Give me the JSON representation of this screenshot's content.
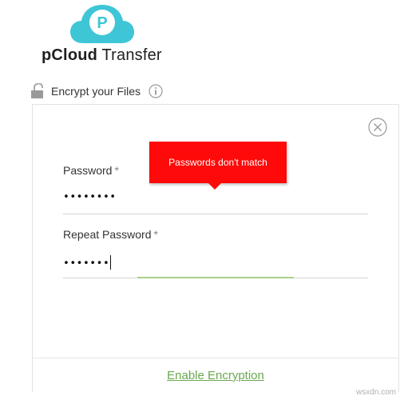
{
  "app": {
    "brand_bold": "pCloud",
    "brand_rest": " Transfer",
    "logo_letter": "P",
    "brand_color": "#3ec6d6"
  },
  "encrypt": {
    "label": "Encrypt your Files",
    "lock_icon": "padlock-open-icon",
    "info_icon": "info-circle-icon"
  },
  "form": {
    "password": {
      "label": "Password",
      "required": "*",
      "value": "••••••••"
    },
    "repeat_password": {
      "label": "Repeat Password",
      "required": "*",
      "value": "•••••••"
    },
    "error_tooltip": "Passwords don't match",
    "error_color": "#ff0a0a"
  },
  "footer": {
    "enable_label": "Enable Encryption",
    "link_color": "#6aa84f"
  },
  "watermark": "wsxdn.com"
}
